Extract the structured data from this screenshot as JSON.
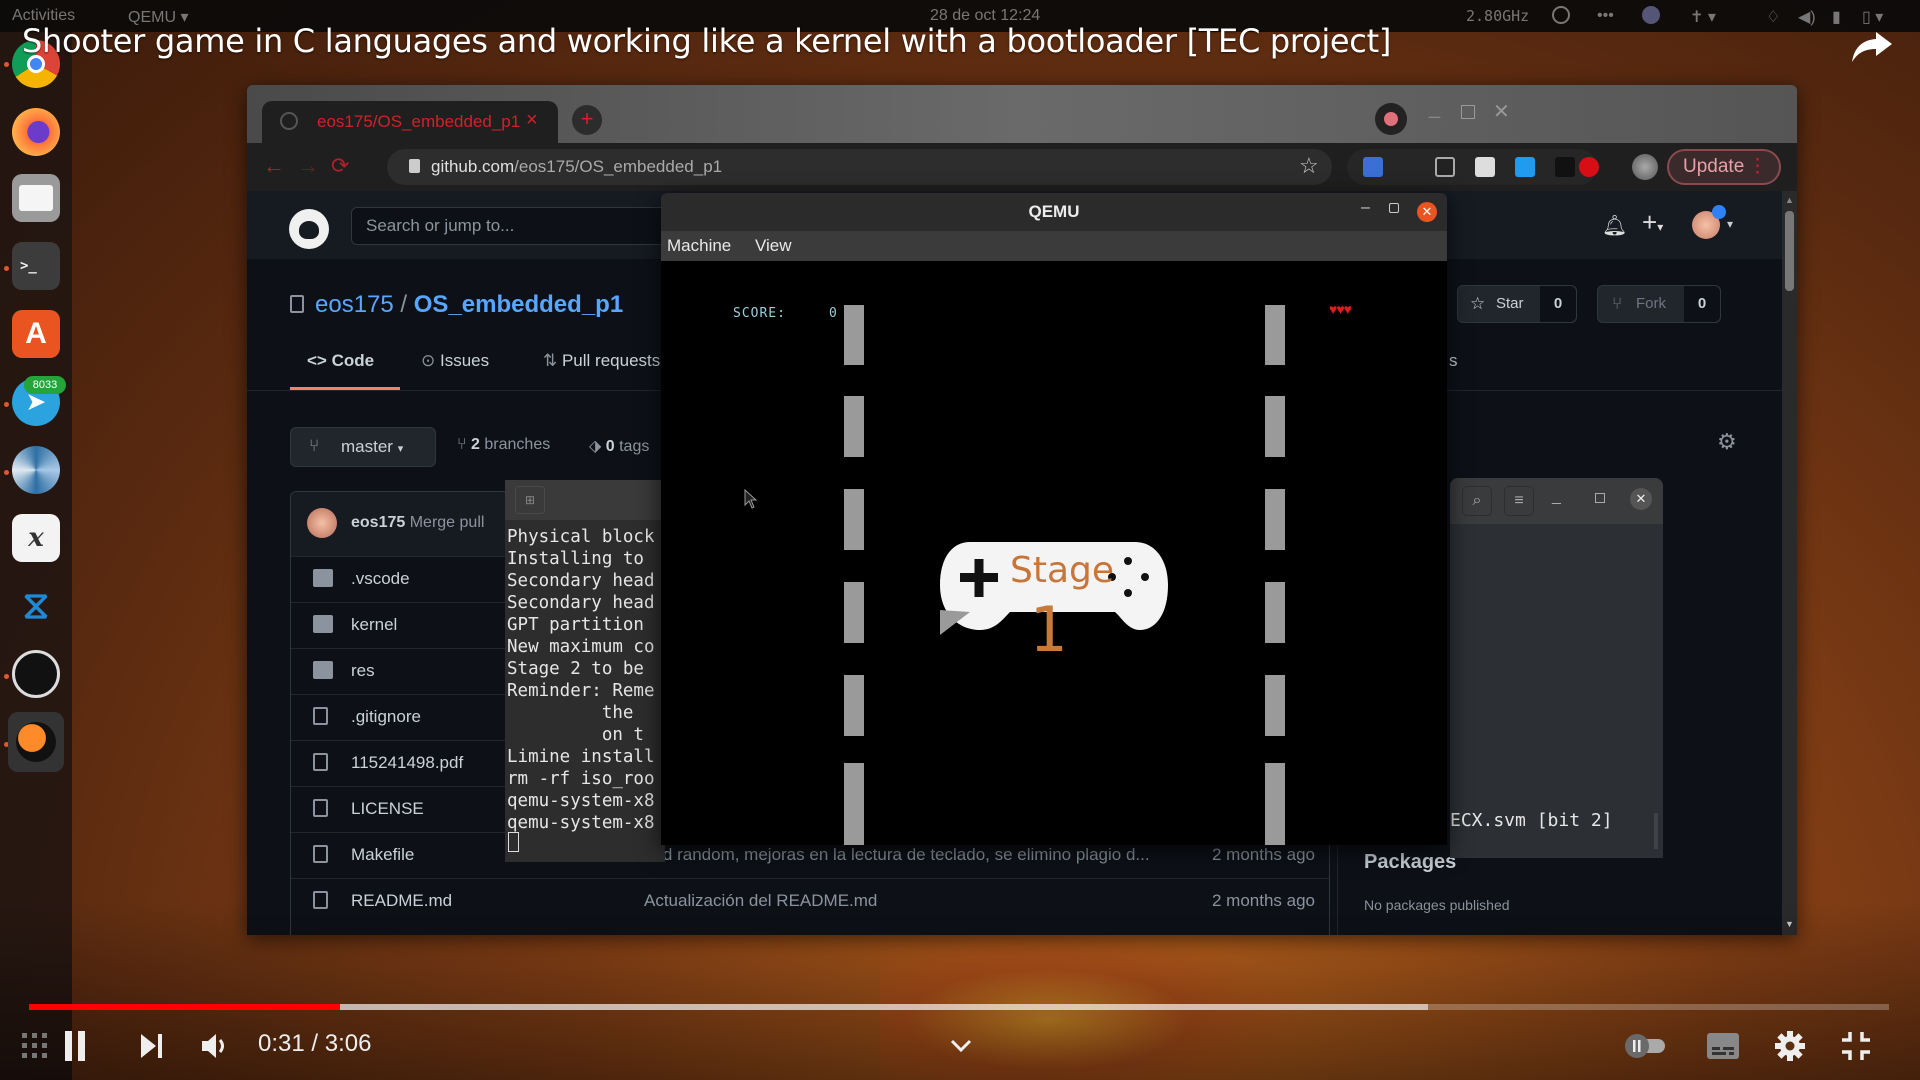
{
  "system": {
    "activities": "Activities",
    "app_menu": "QEMU ▾",
    "clock": "28 de oct  12:24",
    "cpu_indicator": "2.80GHz",
    "tray_icons": [
      "obs-icon",
      "more-icon",
      "network-icon",
      "accessibility-icon",
      "vpn-icon",
      "volume-icon",
      "microphone-icon",
      "battery-icon"
    ]
  },
  "video": {
    "title": "Shooter game in C languages and working like a kernel with a bootloader [TEC project]",
    "current_time": "0:31",
    "duration": "3:06",
    "time_display": "0:31 / 3:06",
    "played_fraction": 0.167,
    "buffered_fraction": 0.752,
    "controls": [
      "pause",
      "next",
      "volume",
      "autoplay-toggle",
      "subtitles",
      "settings",
      "exit-fullscreen"
    ]
  },
  "dock": {
    "apps": [
      {
        "name": "Google Chrome",
        "icon": "chrome-icon",
        "running": true
      },
      {
        "name": "Firefox",
        "icon": "firefox-icon",
        "running": false
      },
      {
        "name": "Files",
        "icon": "files-icon",
        "running": false
      },
      {
        "name": "Terminal",
        "icon": "terminal-icon",
        "running": true
      },
      {
        "name": "Ubuntu Software",
        "icon": "software-center-icon",
        "running": false
      },
      {
        "name": "Telegram",
        "icon": "telegram-icon",
        "running": true,
        "badge": "8033"
      },
      {
        "name": "Shutter",
        "icon": "aperture-icon",
        "running": true
      },
      {
        "name": "Xournal",
        "icon": "xournal-icon",
        "running": false
      },
      {
        "name": "Visual Studio Code",
        "icon": "vscode-icon",
        "running": false
      },
      {
        "name": "OBS Studio",
        "icon": "obs-icon",
        "running": true
      },
      {
        "name": "QEMU",
        "icon": "qemu-icon",
        "running": true
      }
    ]
  },
  "browser": {
    "tab_title": "eos175/OS_embedded_p1",
    "new_tab": "+",
    "url_host": "github.com",
    "url_path": "/eos175/OS_embedded_p1",
    "update_label": "Update",
    "menu_dots": "⋮"
  },
  "github": {
    "search_placeholder": "Search or jump to...",
    "owner": "eos175",
    "separator": "/",
    "repo": "OS_embedded_p1",
    "star_label": "Star",
    "star_count": "0",
    "fork_label": "Fork",
    "fork_count": "0",
    "tabs": [
      {
        "label": "Code",
        "icon": "code-icon",
        "active": true
      },
      {
        "label": "Issues",
        "icon": "issue-icon",
        "active": false
      },
      {
        "label": "Pull requests",
        "icon": "pull-request-icon",
        "active": false
      }
    ],
    "tab_partial_right": "s",
    "branch": "master",
    "branches_count": "2",
    "branches_label": "branches",
    "tags_count": "0",
    "tags_label": "tags",
    "commit_author": "eos175",
    "commit_message": "Merge pull",
    "files": [
      {
        "name": ".vscode",
        "type": "folder",
        "message": "",
        "age": ""
      },
      {
        "name": "kernel",
        "type": "folder",
        "message": "",
        "age": ""
      },
      {
        "name": "res",
        "type": "folder",
        "message": "",
        "age": ""
      },
      {
        "name": ".gitignore",
        "type": "file",
        "message": "",
        "age": ""
      },
      {
        "name": "115241498.pdf",
        "type": "file",
        "message": "",
        "age": ""
      },
      {
        "name": "LICENSE",
        "type": "file",
        "message": "",
        "age": ""
      },
      {
        "name": "Makefile",
        "type": "file",
        "message": "add random, mejoras en la lectura de teclado, se elimino plagio d...",
        "age": "2 months ago"
      },
      {
        "name": "README.md",
        "type": "file",
        "message": "Actualización del README.md",
        "age": "2 months ago"
      }
    ],
    "packages_title": "Packages",
    "packages_empty": "No packages published"
  },
  "terminal_left": {
    "lines": [
      "Physical block",
      "Installing to",
      "Secondary head",
      "Secondary head",
      "GPT partition",
      "New maximum co",
      "Stage 2 to be",
      "Reminder: Reme",
      "         the",
      "         on t",
      "Limine install",
      "rm -rf iso_roo",
      "qemu-system-x8",
      "qemu-system-x8"
    ]
  },
  "terminal_right": {
    "visible_line": "ECX.svm [bit 2]"
  },
  "qemu": {
    "title": "QEMU",
    "menu": [
      "Machine",
      "View"
    ],
    "game": {
      "score_label": "SCORE:",
      "score": "0",
      "lives": 3,
      "lives_glyph": "♥♥♥",
      "stage_label": "Stage",
      "stage_number": "1",
      "lane_segments_per_side": 7
    }
  },
  "colors": {
    "youtube_red": "#ff0000",
    "github_link": "#58a6ff",
    "chrome_accent": "#d3202a",
    "ubuntu_orange": "#e95420",
    "score_cyan": "#9ad0d8",
    "stage_orange": "#c87a3a",
    "ship_blue": "#3a32b0"
  }
}
